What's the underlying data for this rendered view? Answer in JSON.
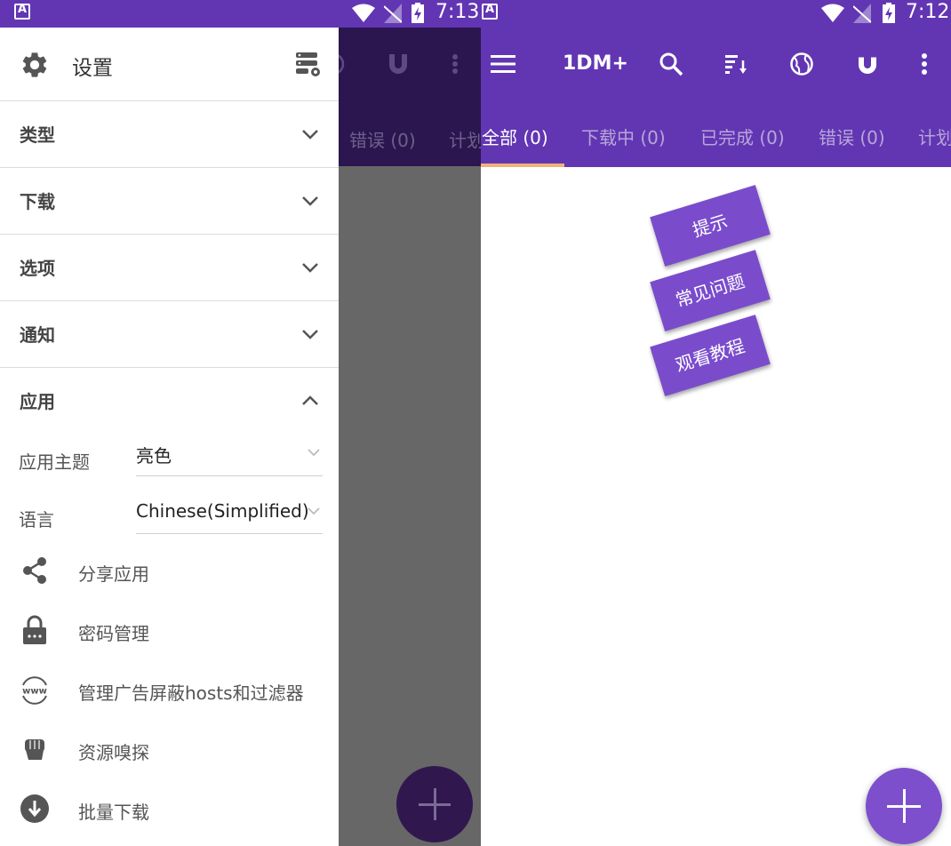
{
  "left_screen": {
    "status_time": "7:13",
    "background_tabs": [
      "错误 (0)",
      "计划"
    ],
    "drawer": {
      "title": "设置",
      "sections": [
        "类型",
        "下载",
        "选项",
        "通知",
        "应用"
      ],
      "app_settings": {
        "theme_label": "应用主题",
        "theme_value": "亮色",
        "language_label": "语言",
        "language_value": "Chinese(Simplified)"
      },
      "menu_items": [
        "分享应用",
        "密码管理",
        "管理广告屏蔽hosts和过滤器",
        "资源嗅探",
        "批量下载"
      ]
    }
  },
  "right_screen": {
    "status_time": "7:12",
    "app_title": "1DM+",
    "tabs": [
      "全部 (0)",
      "下载中 (0)",
      "已完成 (0)",
      "错误 (0)",
      "计划"
    ],
    "tip_buttons": [
      "提示",
      "常见问题",
      "观看教程"
    ]
  },
  "colors": {
    "primary": "#6236b3",
    "accent_indicator": "#f0b27a",
    "fab": "#7d4fcd",
    "tip_button": "#7a4ccc"
  }
}
